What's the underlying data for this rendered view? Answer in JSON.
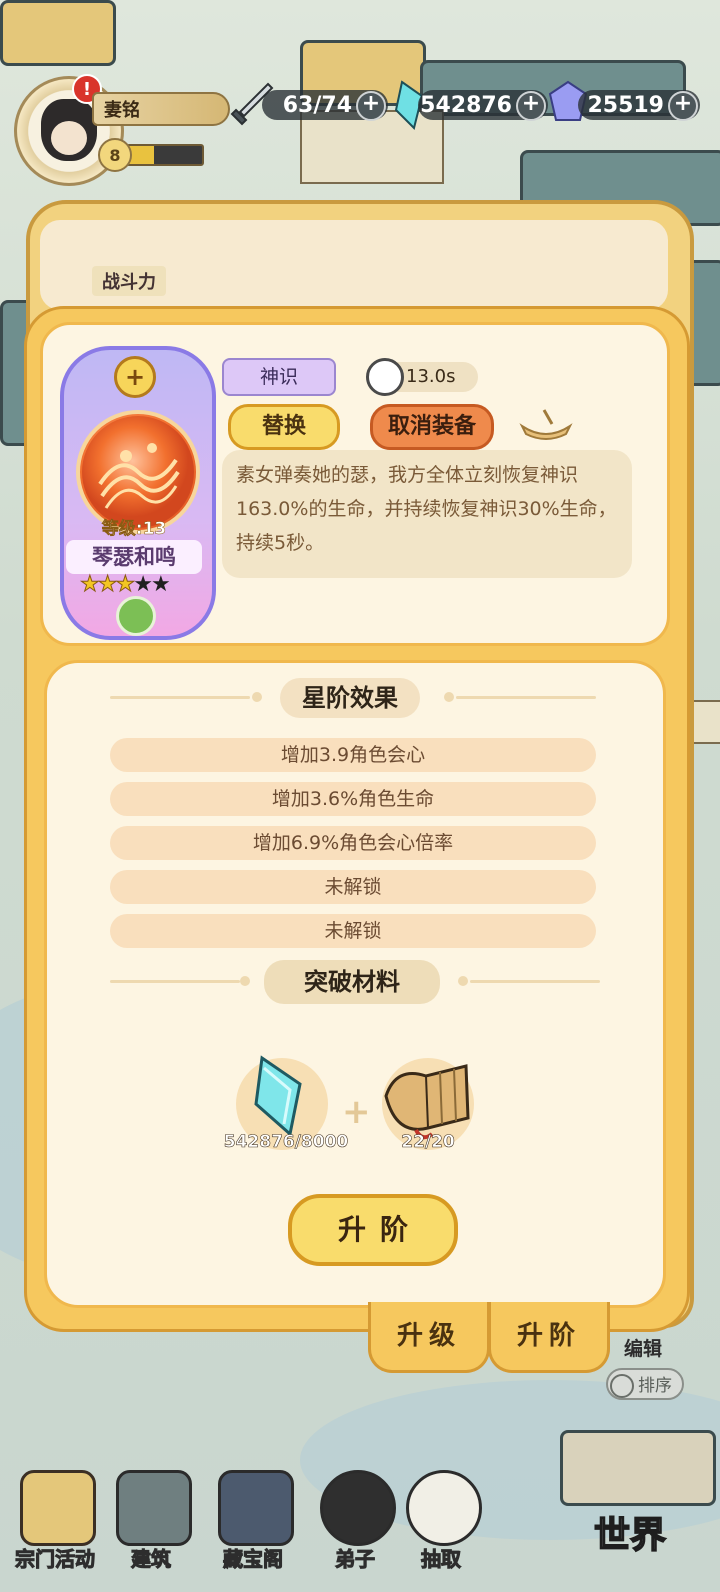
{
  "player": {
    "name": "妻铭",
    "level": "8",
    "alert": "!",
    "exp_fraction": 0.35
  },
  "resources": {
    "stamina": "63/74",
    "jade": "542876",
    "gems": "25519",
    "plus": "+"
  },
  "background": {
    "battle_tag": "战斗力"
  },
  "skill": {
    "type_tag": "神识",
    "cooldown": "13.0s",
    "replace_label": "替换",
    "unequip_label": "取消装备",
    "description": "素女弹奏她的瑟，我方全体立刻恢复神识163.0%的生命，并持续恢复神识30%生命，持续5秒。",
    "card": {
      "level": "等级:13",
      "name": "琴瑟和鸣",
      "stars_filled": 3,
      "stars_total": 5,
      "add_badge": "+"
    }
  },
  "star_effects": {
    "title": "星阶效果",
    "rows": [
      "增加3.9角色会心",
      "增加3.6%角色生命",
      "增加6.9%角色会心倍率",
      "未解锁",
      "未解锁"
    ]
  },
  "materials": {
    "title": "突破材料",
    "plus": "+",
    "items": [
      {
        "icon": "crystal-icon",
        "count": "542876/8000"
      },
      {
        "icon": "scroll-icon",
        "count": "22/20"
      }
    ]
  },
  "advance_button": "升阶",
  "tabs": {
    "upgrade": "升级",
    "advance": "升阶"
  },
  "side": {
    "edit": "编辑",
    "sort": "排序"
  },
  "nav": {
    "items": [
      "宗门活动",
      "建筑",
      "藏宝阁",
      "弟子",
      "抽取"
    ],
    "world": "世界"
  },
  "colors": {
    "panel": "#f6c85e",
    "panel_border": "#d59a33",
    "card_purple": "#8a7ae6",
    "unequip_orange": "#ef8a4c",
    "button_yellow": "#f9dc6c"
  }
}
